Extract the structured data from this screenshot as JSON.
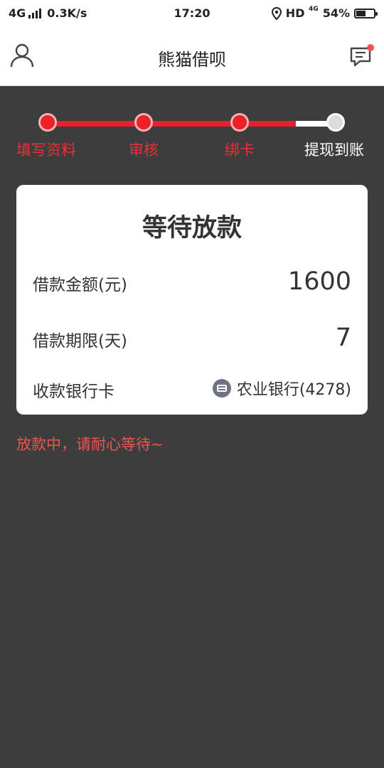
{
  "status_bar": {
    "network": "4G",
    "speed": "0.3K/s",
    "time": "17:20",
    "hd": "HD",
    "hd_sub": "4G",
    "battery": "54%",
    "battery_level": 0.54
  },
  "header": {
    "title": "熊猫借呗",
    "profile_icon": "person-icon",
    "message_icon": "chat-icon",
    "has_unread": true
  },
  "progress": {
    "completed_fraction": 0.86,
    "steps": [
      {
        "label": "填写资料",
        "done": true
      },
      {
        "label": "审核",
        "done": true
      },
      {
        "label": "绑卡",
        "done": true
      },
      {
        "label": "提现到账",
        "done": false
      }
    ]
  },
  "card": {
    "title": "等待放款",
    "rows": [
      {
        "label": "借款金额(元)",
        "value": "1600"
      },
      {
        "label": "借款期限(天)",
        "value": "7"
      },
      {
        "label": "收款银行卡",
        "value": "农业银行(4278)",
        "icon": "bank-card-icon"
      }
    ]
  },
  "note": "放款中，请耐心等待~",
  "colors": {
    "accent": "#e8202a",
    "background": "#3d3d3d",
    "note": "#ef5350"
  }
}
